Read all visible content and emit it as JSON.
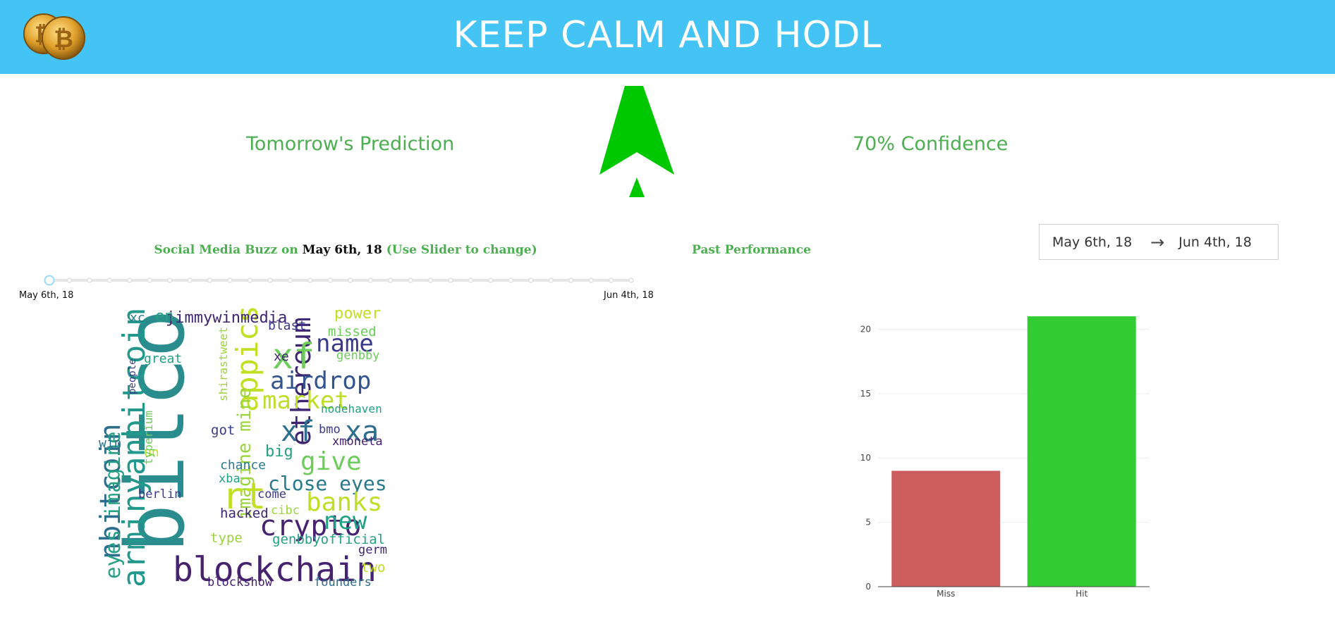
{
  "header": {
    "title": "KEEP CALM AND HODL",
    "logo_icon": "bitcoin-coins-icon",
    "bg_color": "#44c4f5"
  },
  "prediction": {
    "label": "Tomorrow's Prediction",
    "direction": "up",
    "arrow_icon": "up-arrow-icon",
    "arrow_color": "#00c800",
    "confidence_label": "70% Confidence"
  },
  "buzz": {
    "prefix": "Social Media Buzz on ",
    "date": "May 6th, 18",
    "suffix": " (Use Slider to change)",
    "slider_start_label": "May 6th, 18",
    "slider_end_label": "Jun 4th, 18",
    "slider_value_index": 0,
    "slider_steps": 30
  },
  "performance": {
    "title": "Past Performance",
    "range_start": "May 6th, 18",
    "range_arrow": "→",
    "range_end": "Jun 4th, 18"
  },
  "wordcloud": [
    {
      "text": "bitcoin",
      "color": "#2a8c8c"
    },
    {
      "text": "blockchain",
      "color": "#46226f"
    },
    {
      "text": "arminyanbitcoin",
      "color": "#21988b"
    },
    {
      "text": "nbitcoin",
      "color": "#2d6d8e"
    },
    {
      "text": "eyes imagine",
      "color": "#25a083"
    },
    {
      "text": "appics",
      "color": "#c2df23"
    },
    {
      "text": "imagine mine",
      "color": "#9ad53c"
    },
    {
      "text": "ethereum",
      "color": "#3d2572"
    },
    {
      "text": "rt",
      "color": "#c2df23"
    },
    {
      "text": "xf",
      "color": "#6ccd5a"
    },
    {
      "text": "name",
      "color": "#3a3a8c"
    },
    {
      "text": "airdrop",
      "color": "#31548e"
    },
    {
      "text": "market",
      "color": "#bddf26"
    },
    {
      "text": "xf",
      "color": "#2d6d8e"
    },
    {
      "text": "xa",
      "color": "#2d6d8e"
    },
    {
      "text": "give",
      "color": "#6ccd5a"
    },
    {
      "text": "close eyes",
      "color": "#29798e"
    },
    {
      "text": "banks",
      "color": "#bddf26"
    },
    {
      "text": "crypto",
      "color": "#46226f"
    },
    {
      "text": "new",
      "color": "#1fa287"
    },
    {
      "text": "jimmywinmedia",
      "color": "#3d2572"
    },
    {
      "text": "power",
      "color": "#c2df23"
    },
    {
      "text": "missed",
      "color": "#6ccd5a"
    },
    {
      "text": "genbby",
      "color": "#6ccd5a"
    },
    {
      "text": "nodehaven",
      "color": "#25a083"
    },
    {
      "text": "xmoneta",
      "color": "#46226f"
    },
    {
      "text": "bmo",
      "color": "#3a3a8c"
    },
    {
      "text": "big",
      "color": "#25a083"
    },
    {
      "text": "got",
      "color": "#3a3a8c"
    },
    {
      "text": "chance",
      "color": "#29798e"
    },
    {
      "text": "xba",
      "color": "#25a083"
    },
    {
      "text": "come",
      "color": "#3a3a8c"
    },
    {
      "text": "hacked",
      "color": "#3d2572"
    },
    {
      "text": "cibc",
      "color": "#9ad53c"
    },
    {
      "text": "type",
      "color": "#9ad53c"
    },
    {
      "text": "genbbyofficial",
      "color": "#25a083"
    },
    {
      "text": "germ",
      "color": "#3d2572"
    },
    {
      "text": "two",
      "color": "#c2df23"
    },
    {
      "text": "founders",
      "color": "#2d6d8e"
    },
    {
      "text": "blockshow",
      "color": "#46226f"
    },
    {
      "text": "berlin",
      "color": "#3a3a8c"
    },
    {
      "text": "un",
      "color": "#c2df23"
    },
    {
      "text": "win",
      "color": "#2d6d8e"
    },
    {
      "text": "typerium",
      "color": "#6ccd5a"
    },
    {
      "text": "people",
      "color": "#3a3a8c"
    },
    {
      "text": "great",
      "color": "#25a083"
    },
    {
      "text": "xc",
      "color": "#29798e"
    },
    {
      "text": "en",
      "color": "#25a083"
    },
    {
      "text": "blast",
      "color": "#3a3a8c"
    },
    {
      "text": "xe",
      "color": "#3d2572"
    },
    {
      "text": "shirastweet",
      "color": "#9ad53c"
    }
  ],
  "chart_data": {
    "type": "bar",
    "categories": [
      "Miss",
      "Hit"
    ],
    "values": [
      9,
      21
    ],
    "colors": [
      "#cd5c5c",
      "#32cd32"
    ],
    "ylim": [
      0,
      21.5
    ],
    "yticks": [
      0,
      5,
      10,
      15,
      20
    ],
    "grid": true,
    "title": "",
    "xlabel": "",
    "ylabel": ""
  }
}
